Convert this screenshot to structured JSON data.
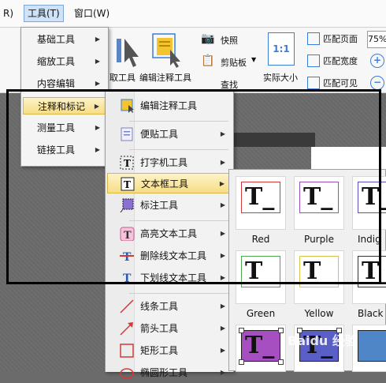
{
  "menubar": {
    "left_partial": "R)",
    "tools": "工具(T)",
    "window": "窗口(W)"
  },
  "ribbon": {
    "take_tool": "取工具",
    "edit_annot_tool": "编辑注释工具",
    "snapshot": "快照",
    "clipboard": "剪贴板",
    "find": "查找",
    "actual_size": "实际大小",
    "fit_page": "匹配页面",
    "fit_width": "匹配宽度",
    "fit_visible": "匹配可见",
    "zoom_value": "75%",
    "actual_size_icon_text": "1:1"
  },
  "tools_menu": {
    "items": [
      "基础工具",
      "缩放工具",
      "内容编辑",
      "注释和标记",
      "测量工具",
      "链接工具"
    ]
  },
  "annot_menu": {
    "items": [
      "编辑注释工具",
      "便贴工具",
      "打字机工具",
      "文本框工具",
      "标注工具",
      "高亮文本工具",
      "删除线文本工具",
      "下划线文本工具",
      "线条工具",
      "箭头工具",
      "矩形工具",
      "椭圆形工具"
    ]
  },
  "gallery": {
    "tiles": [
      {
        "name": "Red",
        "color": "#d23a3a"
      },
      {
        "name": "Purple",
        "color": "#9a4fbf"
      },
      {
        "name": "Indig",
        "color": "#5a4fbf"
      },
      {
        "name": "Green",
        "color": "#4fa84f"
      },
      {
        "name": "Yellow",
        "color": "#d8c24a"
      },
      {
        "name": "Black",
        "color": "#333333"
      }
    ],
    "glyph": "T_"
  },
  "watermark": "Baidu 经验"
}
